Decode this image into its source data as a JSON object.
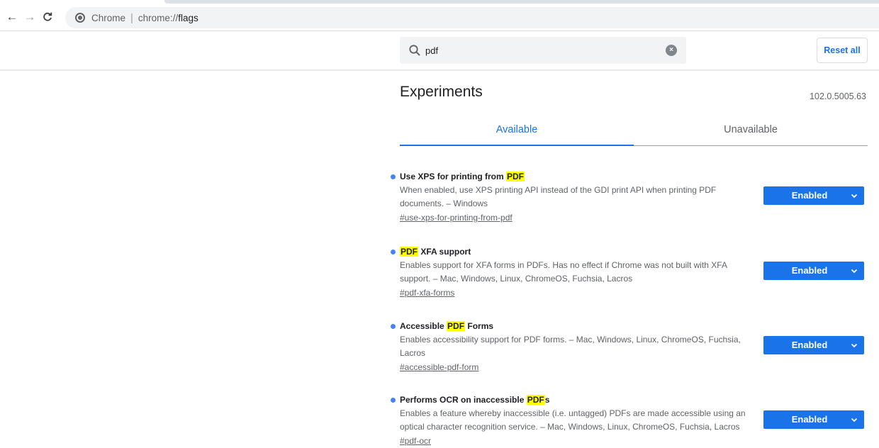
{
  "browser": {
    "site_name": "Chrome",
    "url_scheme": "chrome://",
    "url_path": "flags"
  },
  "header": {
    "search_value": "pdf",
    "reset_label": "Reset all"
  },
  "page": {
    "title": "Experiments",
    "version": "102.0.5005.63",
    "tabs": [
      {
        "label": "Available",
        "active": true
      },
      {
        "label": "Unavailable",
        "active": false
      }
    ]
  },
  "experiments": [
    {
      "name_before": "Use XPS for printing from ",
      "name_highlight": "PDF",
      "name_after": "",
      "description": "When enabled, use XPS printing API instead of the GDI print API when printing PDF documents. – Windows",
      "link": "#use-xps-for-printing-from-pdf",
      "state": "Enabled"
    },
    {
      "name_before": "",
      "name_highlight": "PDF",
      "name_after": " XFA support",
      "description": "Enables support for XFA forms in PDFs. Has no effect if Chrome was not built with XFA support. – Mac, Windows, Linux, ChromeOS, Fuchsia, Lacros",
      "link": "#pdf-xfa-forms",
      "state": "Enabled"
    },
    {
      "name_before": "Accessible ",
      "name_highlight": "PDF",
      "name_after": " Forms",
      "description": "Enables accessibility support for PDF forms. – Mac, Windows, Linux, ChromeOS, Fuchsia, Lacros",
      "link": "#accessible-pdf-form",
      "state": "Enabled"
    },
    {
      "name_before": "Performs OCR on inaccessible ",
      "name_highlight": "PDF",
      "name_after": "s",
      "description": "Enables a feature whereby inaccessible (i.e. untagged) PDFs are made accessible using an optical character recognition service. – Mac, Windows, Linux, ChromeOS, Fuchsia, Lacros",
      "link": "#pdf-ocr",
      "state": "Enabled"
    }
  ],
  "colors": {
    "accent": "#1a73e8",
    "highlight": "#ffff00",
    "bullet": "#4285f4"
  }
}
